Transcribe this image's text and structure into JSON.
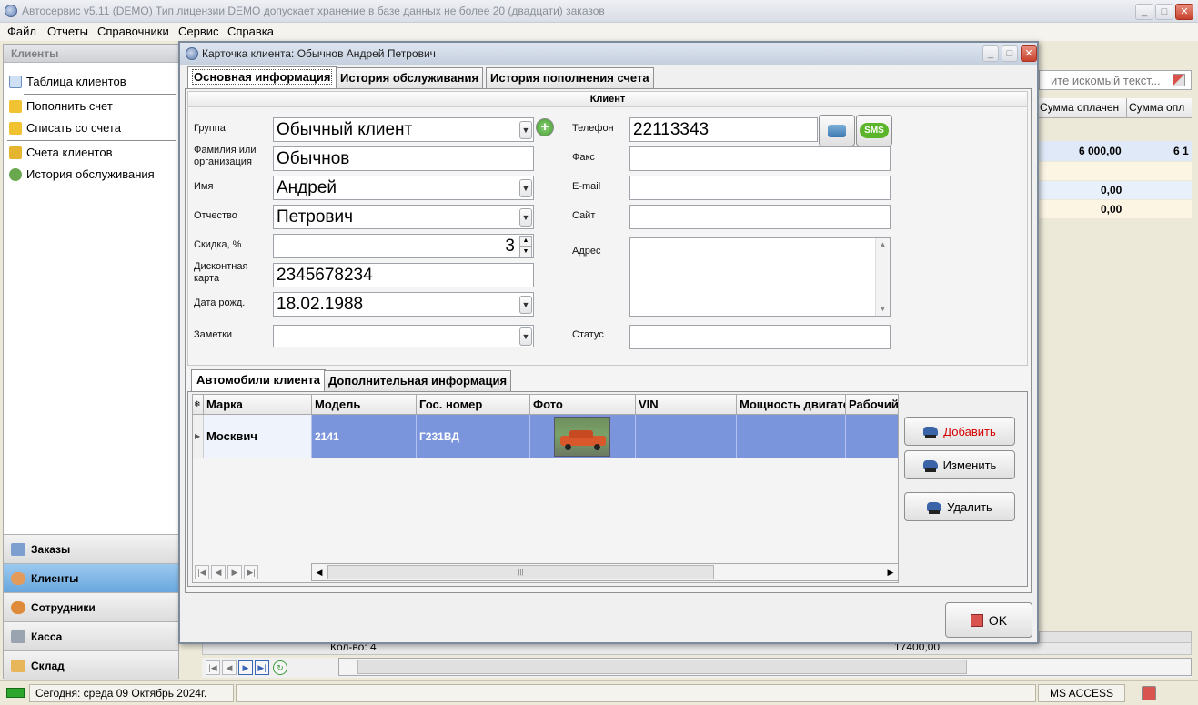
{
  "main_window": {
    "title": "Автосервис v5.11 (DEMO) Тип лицензии DEMO допускает хранение в базе данных не более 20 (двадцати) заказов",
    "menu": [
      "Файл",
      "Отчеты",
      "Справочники",
      "Сервис",
      "Справка"
    ],
    "search_placeholder": "ите искомый текст...",
    "left_panel": {
      "header": "Клиенты",
      "items": [
        "Таблица клиентов",
        "Пополнить счет",
        "Списать со счета",
        "Счета клиентов",
        "История обслуживания"
      ],
      "sections": [
        "Заказы",
        "Клиенты",
        "Сотрудники",
        "Касса",
        "Склад"
      ],
      "active_section": "Клиенты"
    },
    "background_grid": {
      "headers": [
        "Сумма оплачен",
        "Сумма опл"
      ],
      "rows": [
        [
          "6 000,00",
          "6 1"
        ],
        [
          "",
          ""
        ],
        [
          "0,00",
          ""
        ],
        [
          "0,00",
          ""
        ]
      ],
      "footer_count": "Кол-во: 4",
      "footer_sum": "17400,00"
    },
    "status": {
      "today": "Сегодня: среда 09 Октябрь 2024г.",
      "db": "MS ACCESS"
    }
  },
  "dialog": {
    "title": "Карточка клиента: Обычнов Андрей Петрович",
    "tabs": [
      "Основная информация",
      "История обслуживания",
      "История пополнения счета"
    ],
    "section_title": "Клиент",
    "left_fields": {
      "group": {
        "label": "Группа",
        "value": "Обычный клиент"
      },
      "lastname": {
        "label": "Фамилия или организация",
        "value": "Обычнов"
      },
      "firstname": {
        "label": "Имя",
        "value": "Андрей"
      },
      "patronymic": {
        "label": "Отчество",
        "value": "Петрович"
      },
      "discount": {
        "label": "Скидка, %",
        "value": "3"
      },
      "card": {
        "label": "Дисконтная карта",
        "value": "2345678234"
      },
      "birthdate": {
        "label": "Дата рожд.",
        "value": "18.02.1988"
      },
      "notes": {
        "label": "Заметки",
        "value": ""
      }
    },
    "right_fields": {
      "phone": {
        "label": "Телефон",
        "value": "22113343"
      },
      "fax": {
        "label": "Факс",
        "value": ""
      },
      "email": {
        "label": "E-mail",
        "value": ""
      },
      "site": {
        "label": "Сайт",
        "value": ""
      },
      "address": {
        "label": "Адрес",
        "value": ""
      },
      "status": {
        "label": "Статус",
        "value": ""
      }
    },
    "sms_label": "SMS",
    "bottom_tabs": [
      "Автомобили клиента",
      "Дополнительная информация"
    ],
    "cars_grid": {
      "columns": [
        "Марка",
        "Модель",
        "Гос. номер",
        "Фото",
        "VIN",
        "Мощность двигателя",
        "Рабочий"
      ],
      "rows": [
        {
          "brand": "Москвич",
          "model": "2141",
          "plate": "Г231ВД",
          "vin": "",
          "power": "",
          "work": ""
        }
      ]
    },
    "buttons": {
      "add": "Добавить",
      "edit": "Изменить",
      "delete": "Удалить",
      "ok": "OK"
    },
    "colors": {
      "selected_row": "#7b95dd",
      "add_text": "#d40000"
    }
  }
}
